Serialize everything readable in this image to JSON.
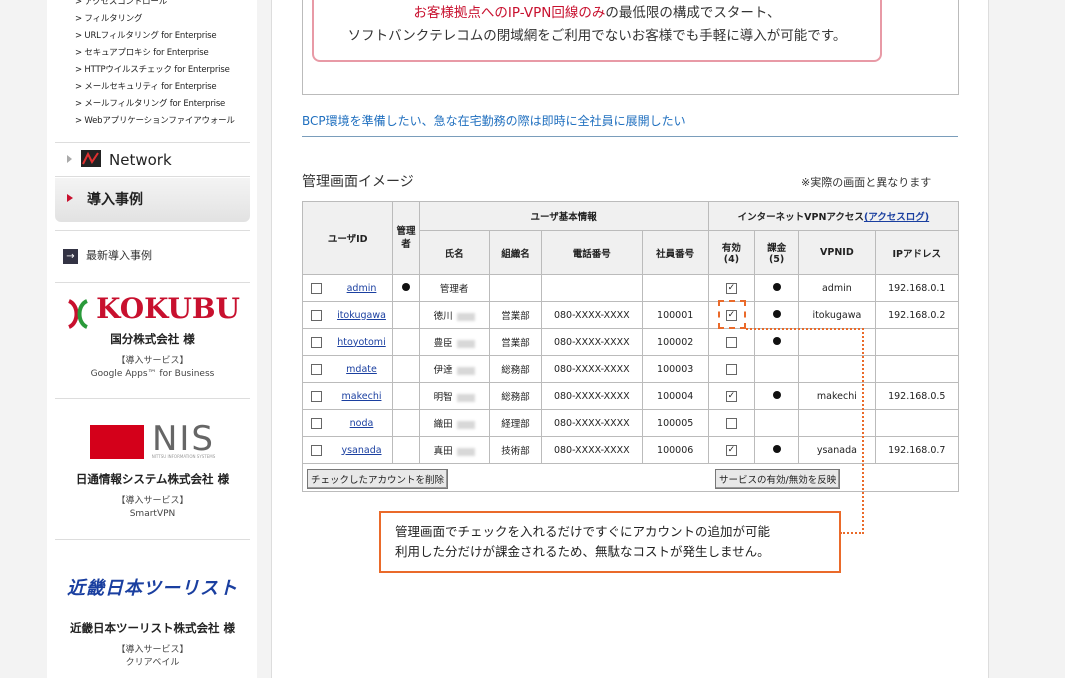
{
  "sidebar": {
    "menu": [
      "> アクセスコントロール",
      "> フィルタリング",
      "> URLフィルタリング for Enterprise",
      "> セキュアプロキシ for Enterprise",
      "> HTTPウイルスチェック for Enterprise",
      "> メールセキュリティ for Enterprise",
      "> メールフィルタリング for Enterprise",
      "> Webアプリケーションファイアウォール"
    ],
    "nav_network": "Network",
    "nav_cases": "導入事例",
    "latest_cases": "最新導入事例",
    "cases": [
      {
        "logo": "KOKUBU",
        "company": "国分株式会社 様",
        "svc_label": "【導入サービス】",
        "svc": "Google Apps™ for Business"
      },
      {
        "logo": "NIS",
        "logo_sub": "NITTSU INFORMATION SYSTEMS",
        "company": "日通情報システム株式会社 様",
        "svc_label": "【導入サービス】",
        "svc": "SmartVPN"
      },
      {
        "logo": "近畿日本ツーリスト",
        "company": "近畿日本ツーリスト株式会社 様",
        "svc_label": "【導入サービス】",
        "svc": "クリアベイル"
      }
    ]
  },
  "main": {
    "pink_line1_red": "お客様拠点へのIP-VPN回線のみ",
    "pink_line1_rest": "の最低限の構成でスタート、",
    "pink_line2": "ソフトバンクテレコムの閉域網をご利用でないお客様でも手軽に導入が可能です。",
    "bcp_heading": "BCP環境を準備したい、急な在宅勤務の際は即時に全社員に展開したい",
    "admin_title": "管理画面イメージ",
    "note": "※実際の画面と異なります",
    "table": {
      "h_userid": "ユーザID",
      "h_admin": "管理者",
      "h_userinfo": "ユーザ基本情報",
      "h_vpn": "インターネットVPNアクセス",
      "h_vpn_link": "(アクセスログ)",
      "h_name": "氏名",
      "h_org": "組織名",
      "h_phone": "電話番号",
      "h_empno": "社員番号",
      "h_enabled": "有効 (4)",
      "h_billing": "課金 (5)",
      "h_vpnid": "VPNID",
      "h_ip": "IPアドレス",
      "rows": [
        {
          "id": "admin",
          "admin": true,
          "name": "管理者",
          "blur": false,
          "org": "",
          "phone": "",
          "emp": "",
          "enabled": true,
          "billing": true,
          "vpnid": "admin",
          "ip": "192.168.0.1"
        },
        {
          "id": "itokugawa",
          "admin": false,
          "name": "徳川",
          "blur": true,
          "org": "営業部",
          "phone": "080-XXXX-XXXX",
          "emp": "100001",
          "enabled": true,
          "billing": true,
          "vpnid": "itokugawa",
          "ip": "192.168.0.2"
        },
        {
          "id": "htoyotomi",
          "admin": false,
          "name": "豊臣",
          "blur": true,
          "org": "営業部",
          "phone": "080-XXXX-XXXX",
          "emp": "100002",
          "enabled": false,
          "billing": true,
          "vpnid": "",
          "ip": ""
        },
        {
          "id": "mdate",
          "admin": false,
          "name": "伊達",
          "blur": true,
          "org": "総務部",
          "phone": "080-XXXX-XXXX",
          "emp": "100003",
          "enabled": false,
          "billing": false,
          "vpnid": "",
          "ip": ""
        },
        {
          "id": "makechi",
          "admin": false,
          "name": "明智",
          "blur": true,
          "org": "総務部",
          "phone": "080-XXXX-XXXX",
          "emp": "100004",
          "enabled": true,
          "billing": true,
          "vpnid": "makechi",
          "ip": "192.168.0.5"
        },
        {
          "id": "noda",
          "admin": false,
          "name": "織田",
          "blur": true,
          "org": "経理部",
          "phone": "080-XXXX-XXXX",
          "emp": "100005",
          "enabled": false,
          "billing": false,
          "vpnid": "",
          "ip": ""
        },
        {
          "id": "ysanada",
          "admin": false,
          "name": "真田",
          "blur": true,
          "org": "技術部",
          "phone": "080-XXXX-XXXX",
          "emp": "100006",
          "enabled": true,
          "billing": true,
          "vpnid": "ysanada",
          "ip": "192.168.0.7"
        }
      ],
      "btn_delete": "チェックしたアカウントを削除",
      "btn_reflect": "サービスの有効/無効を反映"
    },
    "callout_line1": "管理画面でチェックを入れるだけですぐにアカウントの追加が可能",
    "callout_line2": "利用した分だけが課金されるため、無駄なコストが発生しません。"
  }
}
